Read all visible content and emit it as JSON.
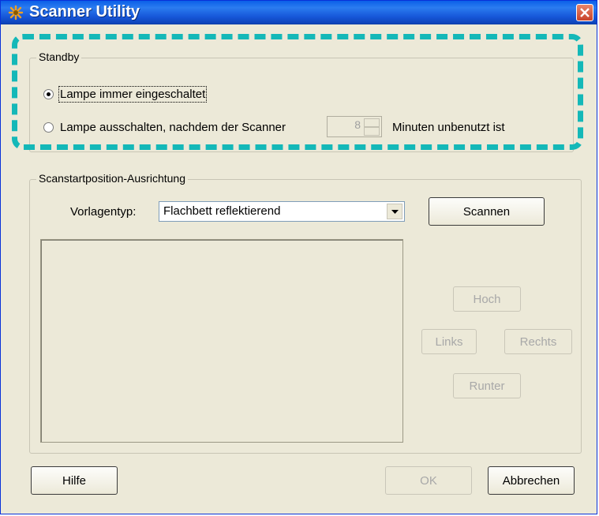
{
  "window": {
    "title": "Scanner Utility"
  },
  "standby": {
    "group_label": "Standby",
    "option_always_on": "Lampe immer eingeschaltet",
    "option_off_after_prefix": "Lampe ausschalten, nachdem der Scanner",
    "minutes_value": "8",
    "option_off_after_suffix": "Minuten unbenutzt ist",
    "selected": "always_on"
  },
  "alignment": {
    "group_label": "Scanstartposition-Ausrichtung",
    "template_label": "Vorlagentyp:",
    "template_value": "Flachbett reflektierend",
    "scan_button": "Scannen",
    "up_button": "Hoch",
    "left_button": "Links",
    "right_button": "Rechts",
    "down_button": "Runter"
  },
  "footer": {
    "help_button": "Hilfe",
    "ok_button": "OK",
    "cancel_button": "Abbrechen"
  },
  "colors": {
    "titlebar": "#0a5fe8",
    "dialog_bg": "#ece9d8",
    "highlight": "#14b8b8",
    "close_button": "#d05a3c"
  }
}
